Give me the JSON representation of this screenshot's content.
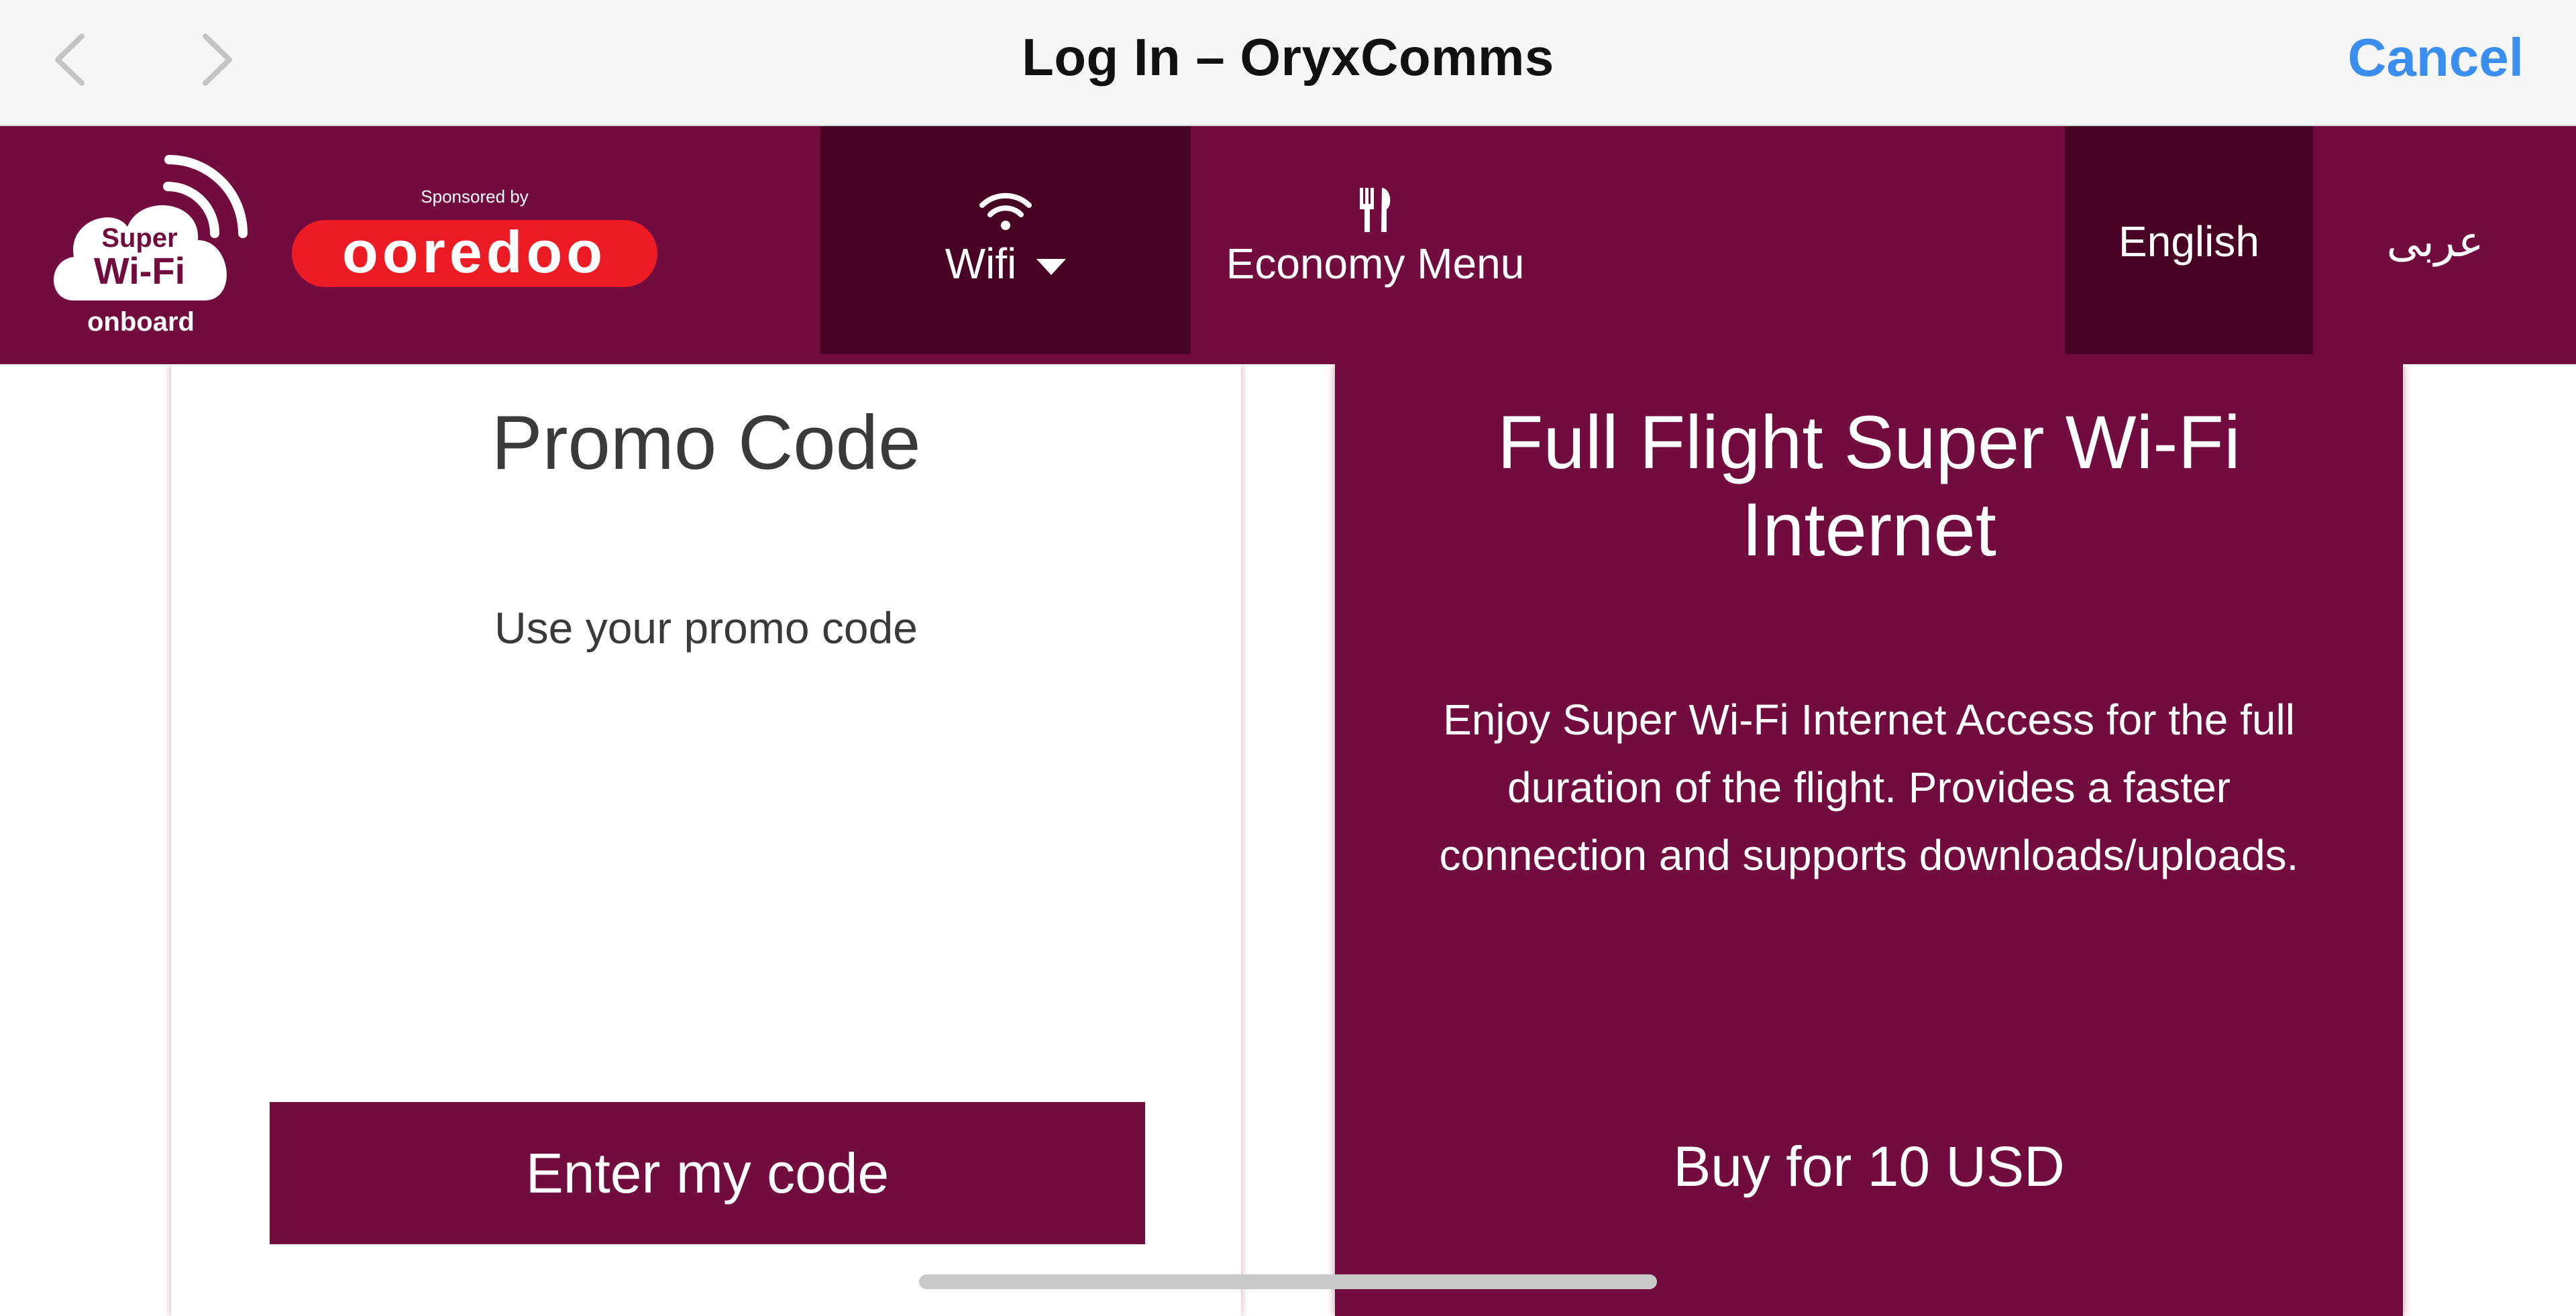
{
  "browser": {
    "title": "Log In – OryxComms",
    "cancel_label": "Cancel"
  },
  "header": {
    "logo": {
      "line1": "Super",
      "line2": "Wi-Fi",
      "line3": "onboard"
    },
    "sponsor_text": "Sponsored by",
    "sponsor_brand": "ooredoo",
    "nav": {
      "wifi_label": "Wifi",
      "menu_label": "Economy Menu",
      "lang_en": "English",
      "lang_ar": "عربى"
    }
  },
  "promo": {
    "title": "Promo Code",
    "subtitle": "Use your promo code",
    "button": "Enter my code"
  },
  "plan": {
    "title": "Full Flight Super Wi-Fi Internet",
    "description": "Enjoy Super Wi-Fi Internet Access for the full duration of the flight. Provides a faster connection and supports downloads/uploads.",
    "buy_label": "Buy for 10 USD"
  },
  "colors": {
    "brand": "#730c3e",
    "brand_dark": "#480223",
    "link": "#3a8ef0",
    "sponsor_red": "#ed1c24"
  }
}
